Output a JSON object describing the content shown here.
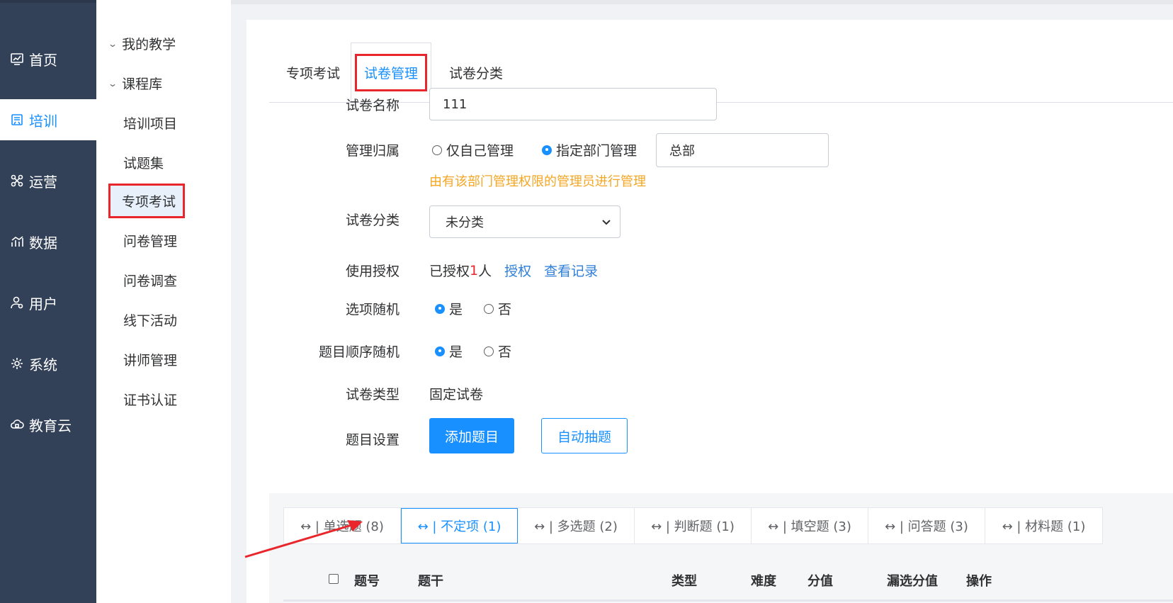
{
  "leftnav": {
    "items": [
      {
        "label": "首页",
        "icon": "dashboard-icon"
      },
      {
        "label": "培训",
        "icon": "training-icon",
        "active": true
      },
      {
        "label": "运营",
        "icon": "operations-icon"
      },
      {
        "label": "数据",
        "icon": "chart-icon"
      },
      {
        "label": "用户",
        "icon": "user-icon"
      },
      {
        "label": "系统",
        "icon": "gear-icon"
      },
      {
        "label": "教育云",
        "icon": "cloud-icon"
      }
    ]
  },
  "sidebar": {
    "groups": [
      "我的教学",
      "课程库"
    ],
    "items": [
      "培训项目",
      "试题集",
      "专项考试",
      "问卷管理",
      "问卷调查",
      "线下活动",
      "讲师管理",
      "证书认证"
    ],
    "active_item": "专项考试"
  },
  "tabs": [
    "专项考试",
    "试卷管理",
    "试卷分类"
  ],
  "active_tab": "试卷管理",
  "form": {
    "name_label": "试卷名称",
    "name_value": "111",
    "owner_label": "管理归属",
    "owner_opt_self": "仅自己管理",
    "owner_opt_dept": "指定部门管理",
    "owner_dept_value": "总部",
    "owner_hint": "由有该部门管理权限的管理员进行管理",
    "category_label": "试卷分类",
    "category_value": "未分类",
    "auth_label": "使用授权",
    "auth_prefix": "已授权",
    "auth_count": "1",
    "auth_suffix": "人",
    "auth_link": "授权",
    "auth_record_link": "查看记录",
    "option_random_label": "选项随机",
    "question_order_label": "题目顺序随机",
    "yes": "是",
    "no": "否",
    "paper_type_label": "试卷类型",
    "paper_type_value": "固定试卷",
    "question_setting_label": "题目设置",
    "add_question_btn": "添加题目",
    "auto_pick_btn": "自动抽题"
  },
  "question_tabs": [
    {
      "label": "↔ | 单选题 (8)"
    },
    {
      "label": "↔ | 不定项 (1)",
      "active": true
    },
    {
      "label": "↔ | 多选题 (2)"
    },
    {
      "label": "↔ | 判断题 (1)"
    },
    {
      "label": "↔ | 填空题 (3)"
    },
    {
      "label": "↔ | 问答题 (3)"
    },
    {
      "label": "↔ | 材料题 (1)"
    }
  ],
  "table_headers": [
    "题号",
    "题干",
    "类型",
    "难度",
    "分值",
    "漏选分值",
    "操作"
  ],
  "colors": {
    "primary": "#1890ff",
    "nav_bg": "#334158",
    "highlight_red": "#e8262c",
    "hint_orange": "#f5a623"
  }
}
